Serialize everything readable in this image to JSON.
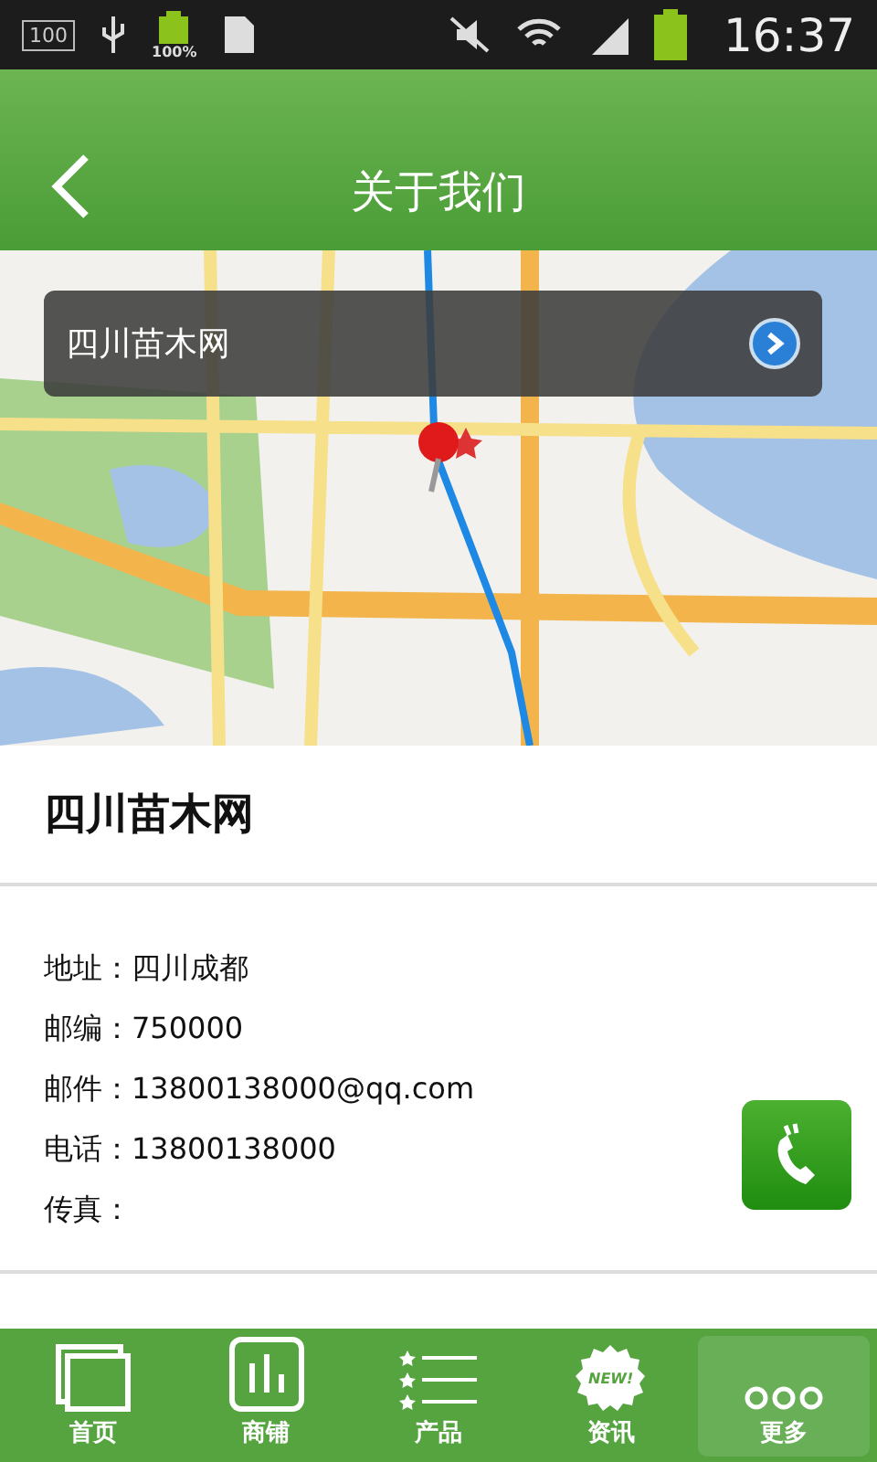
{
  "status_bar": {
    "badge": "100",
    "battery_label": "100%",
    "time": "16:37"
  },
  "header": {
    "title": "关于我们"
  },
  "map": {
    "kind": "picture",
    "popup": {
      "title": "四川苗木网"
    }
  },
  "company": {
    "name": "四川苗木网"
  },
  "info": [
    {
      "label": "地址：",
      "value": "四川成都"
    },
    {
      "label": "邮编：",
      "value": "750000"
    },
    {
      "label": "邮件：",
      "value": "13800138000@qq.com"
    },
    {
      "label": "电话：",
      "value": "13800138000"
    },
    {
      "label": "传真："
    }
  ],
  "nav": [
    {
      "kind": "home",
      "label": "首页",
      "selected": false
    },
    {
      "kind": "shop",
      "label": "商铺",
      "selected": false
    },
    {
      "kind": "products",
      "label": "产品",
      "selected": false
    },
    {
      "kind": "news",
      "label": "资讯",
      "selected": false,
      "badge": "NEW!"
    },
    {
      "kind": "more",
      "label": "更多",
      "selected": true
    }
  ]
}
